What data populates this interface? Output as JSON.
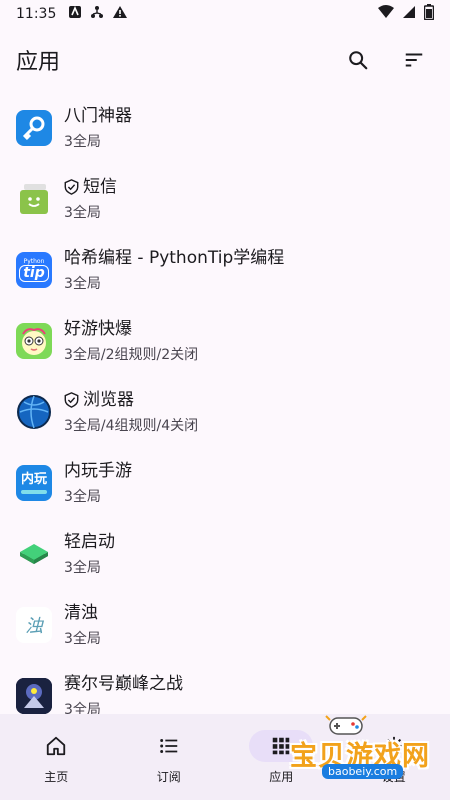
{
  "status_bar": {
    "time": "11:35"
  },
  "app_bar": {
    "title": "应用"
  },
  "apps": [
    {
      "name": "八门神器",
      "sub": "3全局",
      "shield": false,
      "icon": "key-tool-icon"
    },
    {
      "name": "短信",
      "sub": "3全局",
      "shield": true,
      "icon": "message-icon"
    },
    {
      "name": "哈希编程 - PythonTip学编程",
      "sub": "3全局",
      "shield": false,
      "icon": "pythontip-icon"
    },
    {
      "name": "好游快爆",
      "sub": "3全局/2组规则/2关闭",
      "shield": false,
      "icon": "haoyou-icon"
    },
    {
      "name": "浏览器",
      "sub": "3全局/4组规则/4关闭",
      "shield": true,
      "icon": "globe-icon"
    },
    {
      "name": "内玩手游",
      "sub": "3全局",
      "shield": false,
      "icon": "neiwan-icon"
    },
    {
      "name": "轻启动",
      "sub": "3全局",
      "shield": false,
      "icon": "chip-icon"
    },
    {
      "name": "清浊",
      "sub": "3全局",
      "shield": false,
      "icon": "qingzhuo-icon"
    },
    {
      "name": "赛尔号巅峰之战",
      "sub": "3全局",
      "shield": false,
      "icon": "game-icon"
    }
  ],
  "icon_texts": {
    "pythontip_small": "Python",
    "pythontip": "tip",
    "neiwan": "内玩",
    "qingzhuo": "浊"
  },
  "bottom_nav": [
    {
      "label": "主页",
      "active": false
    },
    {
      "label": "订阅",
      "active": false
    },
    {
      "label": "应用",
      "active": true
    },
    {
      "label": "设置",
      "active": false
    }
  ],
  "watermark": {
    "text": "宝贝游戏网",
    "url": "baobeiy.com"
  }
}
